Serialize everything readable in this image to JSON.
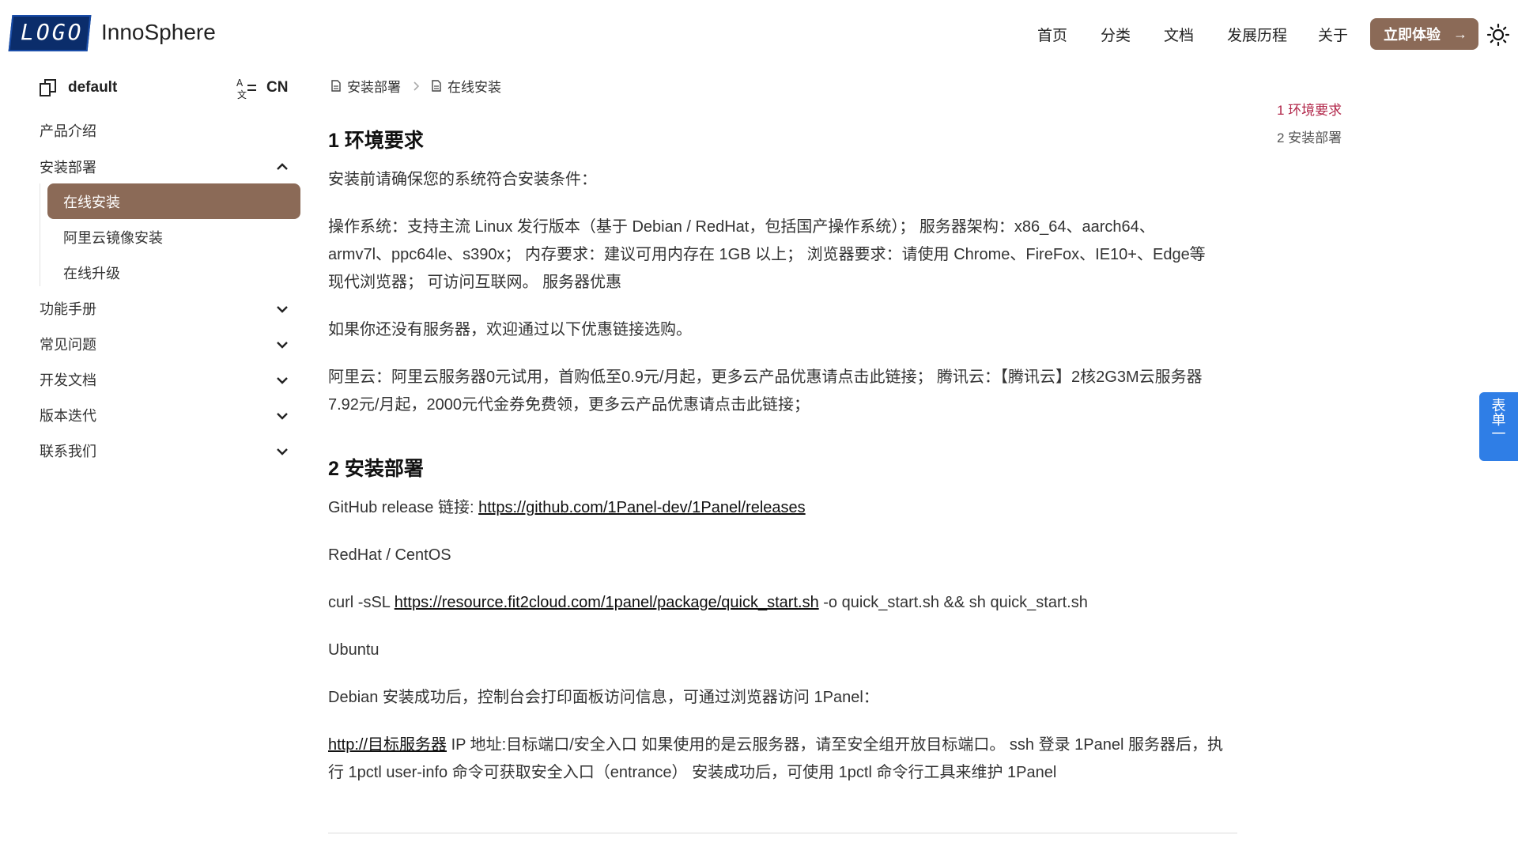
{
  "header": {
    "logo_text": "LOGO",
    "site_name": "InnoSphere",
    "nav": [
      "首页",
      "分类",
      "文档",
      "发展历程",
      "关于"
    ],
    "cta_label": "立即体验",
    "cta_arrow": "→"
  },
  "sidebar": {
    "workspace": "default",
    "lang": "CN",
    "items": [
      {
        "label": "产品介绍"
      },
      {
        "label": "安装部署",
        "expanded": true
      },
      {
        "label": "功能手册"
      },
      {
        "label": "常见问题"
      },
      {
        "label": "开发文档"
      },
      {
        "label": "版本迭代"
      },
      {
        "label": "联系我们"
      }
    ],
    "sub_items": [
      "在线安装",
      "阿里云镜像安装",
      "在线升级"
    ]
  },
  "breadcrumb": [
    "安装部署",
    "在线安装"
  ],
  "content": {
    "h1": "1 环境要求",
    "p1": "安装前请确保您的系统符合安装条件：",
    "p2a": "操作系统：支持主流 Linux 发行版本（基于 Debian / RedHat，包括国产操作系统）； 服务器架构：x86_64、aarch64、",
    "p2b": "armv7l、ppc64le、s390x； 内存要求：建议可用内存在 1GB 以上； 浏览器要求：请使用 Chrome、FireFox、IE10+、Edge等",
    "p2c": "现代浏览器； 可访问互联网。 服务器优惠",
    "p3": "如果你还没有服务器，欢迎通过以下优惠链接选购。",
    "p4a": "阿里云：阿里云服务器0元试用，首购低至0.9元/月起，更多云产品优惠请点击此链接； 腾讯云：【腾讯云】2核2G3M云服务器",
    "p4b": "7.92元/月起，2000元代金券免费领，更多云产品优惠请点击此链接；",
    "h2": "2 安装部署",
    "github_prefix": "GitHub release 链接: ",
    "github_link": "https://github.com/1Panel-dev/1Panel/releases",
    "redhat": "RedHat / CentOS",
    "curl_prefix": "curl -sSL ",
    "curl_link": "https://resource.fit2cloud.com/1panel/package/quick_start.sh",
    "curl_suffix": " -o quick_start.sh && sh quick_start.sh",
    "ubuntu": "Ubuntu",
    "debian": "Debian 安装成功后，控制台会打印面板访问信息，可通过浏览器访问 1Panel：",
    "access_link": "http://目标服务器",
    "access_a": " IP 地址:目标端口/安全入口 如果使用的是云服务器，请至安全组开放目标端口。 ssh 登录 1Panel 服务器后，执",
    "access_b": "行 1pctl user-info 命令可获取安全入口（entrance） 安装成功后，可使用 1pctl 命令行工具来维护 1Panel"
  },
  "toc": [
    {
      "label": "1 环境要求",
      "active": true
    },
    {
      "label": "2 安装部署",
      "active": false
    }
  ],
  "float_tab": {
    "label_1": "表",
    "label_2": "单",
    "label_3": "一"
  },
  "colors": {
    "accent": "#8b6a57",
    "toc_active": "#b2274a",
    "float": "#2f7ee6"
  }
}
